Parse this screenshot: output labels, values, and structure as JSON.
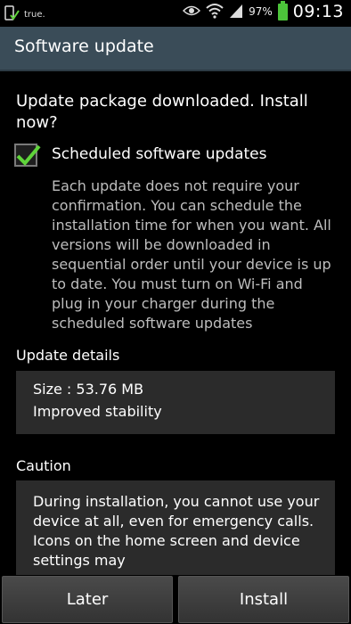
{
  "status_bar": {
    "carrier": "true.",
    "battery_percent": "97%",
    "time": "09:13",
    "icons": [
      "phone-check-icon",
      "eye-icon",
      "wifi-icon",
      "signal-icon",
      "battery-icon"
    ]
  },
  "header": {
    "title": "Software update"
  },
  "main": {
    "prompt": "Update package downloaded. Install now?",
    "scheduled": {
      "label": "Scheduled software updates",
      "checked": true,
      "description": "Each update does not require your confirmation. You can schedule the installation time for when you want. All versions will be downloaded in sequential order until your device is up to date. You must turn on Wi-Fi and plug in your charger during the scheduled software updates"
    },
    "details": {
      "label": "Update details",
      "size": "Size : 53.76 MB",
      "notes": "Improved stability"
    },
    "caution": {
      "label": "Caution",
      "text": "During installation, you cannot use your device at all, even for emergency calls. Icons on the home screen and device settings may"
    }
  },
  "buttons": {
    "later": "Later",
    "install": "Install"
  },
  "colors": {
    "header_bg": "#3a4c58",
    "check_green": "#5fd43a",
    "battery_green": "#4cc43a"
  }
}
